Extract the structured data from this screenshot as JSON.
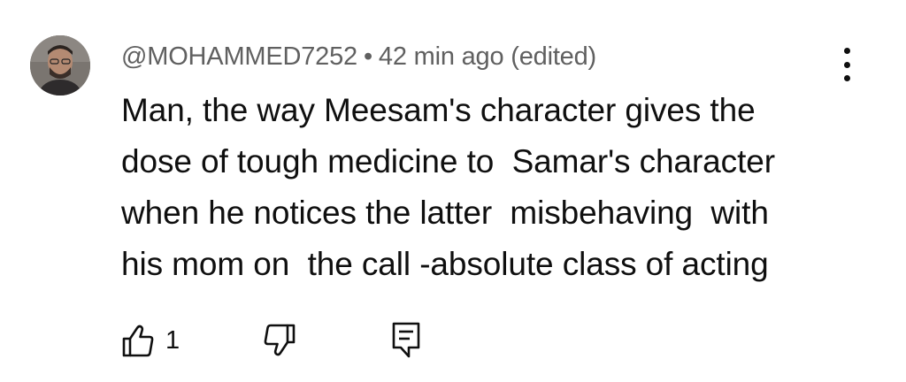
{
  "comment": {
    "author": "@MOHAMMED7252",
    "separator": "•",
    "time": "42 min ago",
    "edited": "(edited)",
    "text_lines": [
      "Man, the way Meesam's character gives the",
      "dose of tough medicine to  Samar's character",
      "when he notices the latter  misbehaving  with",
      "his mom on  the call -absolute class of acting"
    ],
    "like_count": "1"
  },
  "icons": {
    "avatar": "avatar",
    "more": "more-vertical-icon",
    "like": "thumbs-up-icon",
    "dislike": "thumbs-down-icon",
    "reply": "reply-comment-icon"
  },
  "colors": {
    "text": "#0f0f0f",
    "meta": "#606060",
    "background": "#ffffff"
  }
}
